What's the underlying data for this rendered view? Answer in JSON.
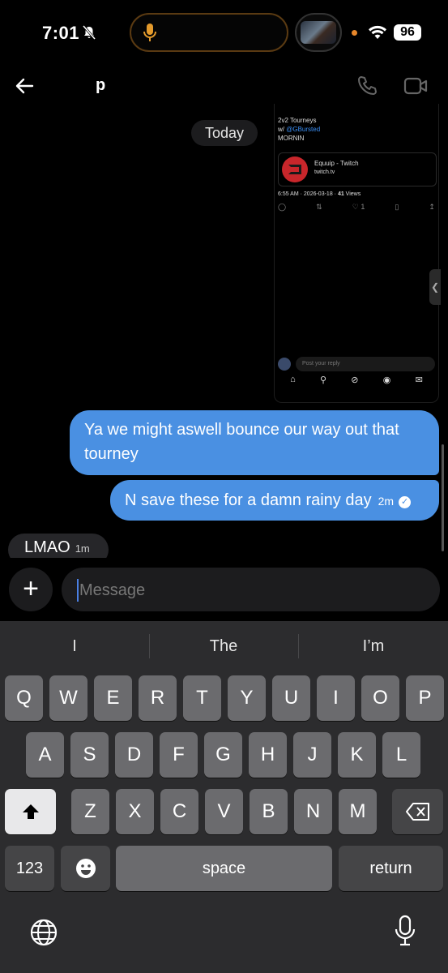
{
  "status_bar": {
    "time": "7:01",
    "battery": "96"
  },
  "header": {
    "contact_name": "p"
  },
  "date_separator": "Today",
  "shared_screenshot": {
    "tweet_lines": [
      "2v2 Tourneys",
      "w/ ",
      "@GBursted",
      "MORNIN"
    ],
    "card_title": "Equuip - Twitch",
    "card_domain": "twitch.tv",
    "meta_time": "6:55 AM · 2026-03-18 · ",
    "meta_views_count": "41",
    "meta_views_label": " Views",
    "like_count": "1",
    "reply_placeholder": "Post your reply"
  },
  "messages": [
    {
      "text": "Ya we might aswell bounce our way out that tourney",
      "direction": "outgoing"
    },
    {
      "text": "N save these for a damn rainy day",
      "time": "2m",
      "direction": "outgoing"
    },
    {
      "text": "LMAO",
      "time": "1m",
      "direction": "incoming"
    }
  ],
  "composer": {
    "placeholder": "Message",
    "plus_label": "+"
  },
  "keyboard": {
    "suggestions": [
      "I",
      "The",
      "I’m"
    ],
    "row1": [
      "Q",
      "W",
      "E",
      "R",
      "T",
      "Y",
      "U",
      "I",
      "O",
      "P"
    ],
    "row2": [
      "A",
      "S",
      "D",
      "F",
      "G",
      "H",
      "J",
      "K",
      "L"
    ],
    "row3": [
      "Z",
      "X",
      "C",
      "V",
      "B",
      "N",
      "M"
    ],
    "numbers_label": "123",
    "space_label": "space",
    "return_label": "return"
  },
  "colors": {
    "outgoing_bubble": "#4a90e2",
    "incoming_bubble": "#262629",
    "link": "#3b8ff5"
  }
}
